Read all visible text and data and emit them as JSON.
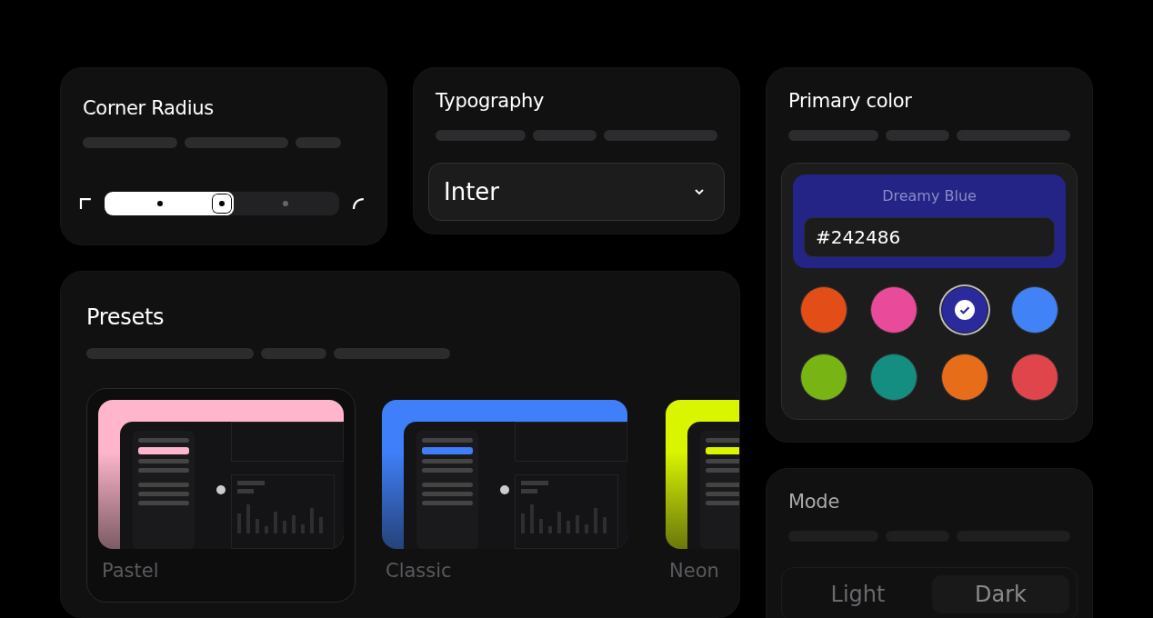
{
  "corner_radius": {
    "title": "Corner Radius",
    "level": 0.55
  },
  "typography": {
    "title": "Typography",
    "font_dropdown": {
      "value": "Inter"
    }
  },
  "primary_color": {
    "title": "Primary color",
    "color_name": "Dreamy Blue",
    "hex_field": {
      "value": "#242486"
    },
    "swatches": [
      {
        "color": "#e34d17",
        "selected": false
      },
      {
        "color": "#ea4a9a",
        "selected": false
      },
      {
        "color": "#2a2a9c",
        "selected": true
      },
      {
        "color": "#4182f7",
        "selected": false
      },
      {
        "color": "#78b514",
        "selected": false
      },
      {
        "color": "#138e80",
        "selected": false
      },
      {
        "color": "#e86d1b",
        "selected": false
      },
      {
        "color": "#e0454b",
        "selected": false
      }
    ]
  },
  "presets": {
    "title": "Presets",
    "items": [
      {
        "label": "Pastel",
        "selected": true,
        "color": "#ffb6cc"
      },
      {
        "label": "Classic",
        "selected": false,
        "color": "#3f7ffa"
      },
      {
        "label": "Neon",
        "selected": false,
        "color": "#d9f500"
      }
    ]
  },
  "mode": {
    "title": "Mode",
    "options": [
      {
        "label": "Light",
        "selected": false
      },
      {
        "label": "Dark",
        "selected": true
      }
    ]
  }
}
